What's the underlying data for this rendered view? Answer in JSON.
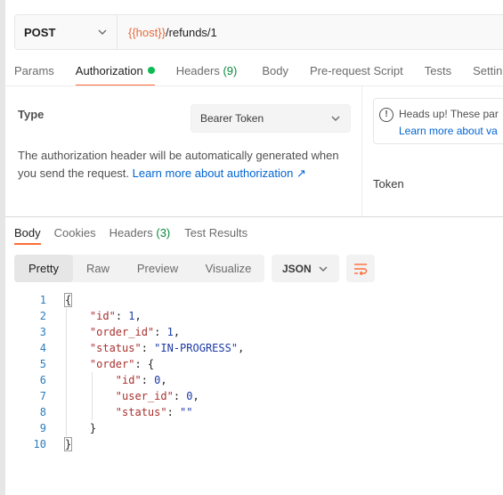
{
  "request": {
    "method": "POST",
    "url_host": "{{host}}",
    "url_path": "/refunds/1"
  },
  "request_tabs": [
    {
      "label": "Params"
    },
    {
      "label": "Authorization"
    },
    {
      "label": "Headers",
      "count": "(9)"
    },
    {
      "label": "Body"
    },
    {
      "label": "Pre-request Script"
    },
    {
      "label": "Tests"
    },
    {
      "label": "Settin"
    }
  ],
  "auth": {
    "type_label": "Type",
    "type_value": "Bearer Token",
    "description": "The authorization header will be automatically generated when you send the request.",
    "learn_more": "Learn more about authorization ↗",
    "headsup_title": "Heads up! These par",
    "headsup_link": "Learn more about va",
    "token_label": "Token"
  },
  "response_tabs": [
    {
      "label": "Body"
    },
    {
      "label": "Cookies"
    },
    {
      "label": "Headers",
      "count": "(3)"
    },
    {
      "label": "Test Results"
    }
  ],
  "format": {
    "buttons": [
      "Pretty",
      "Raw",
      "Preview",
      "Visualize"
    ],
    "language": "JSON"
  },
  "code_lines": [
    "1",
    "2",
    "3",
    "4",
    "5",
    "6",
    "7",
    "8",
    "9",
    "10"
  ],
  "json_body": {
    "k_id": "\"id\"",
    "v_id": "1",
    "k_order_id": "\"order_id\"",
    "v_order_id": "1",
    "k_status": "\"status\"",
    "v_status": "\"IN-PROGRESS\"",
    "k_order": "\"order\"",
    "k_o_id": "\"id\"",
    "v_o_id": "0",
    "k_user_id": "\"user_id\"",
    "v_user_id": "0",
    "k_o_status": "\"status\"",
    "v_o_status": "\"\""
  },
  "colors": {
    "accent": "#ff6c37",
    "link": "#0265d2",
    "status_green": "#0cbb52"
  }
}
